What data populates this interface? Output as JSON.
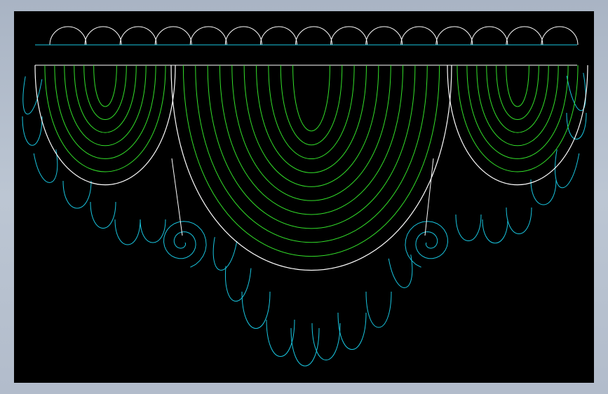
{
  "drawing": {
    "background": "#000000",
    "frame_gradient": [
      "#a9b4c4",
      "#bcc6d3"
    ],
    "colors": {
      "outline": "#ffffff",
      "pleat": "#33e02a",
      "trim": "#19c6e0"
    },
    "pelmet": {
      "scallop_count": 15
    },
    "swags": {
      "left_fold_count": 6,
      "center_fold_count": 10,
      "right_fold_count": 6
    },
    "tails": {
      "bells_left_side": 3,
      "bells_left_swag": 4,
      "bells_center_swag": 9,
      "bells_right_swag": 4,
      "bells_right_side": 3
    }
  }
}
